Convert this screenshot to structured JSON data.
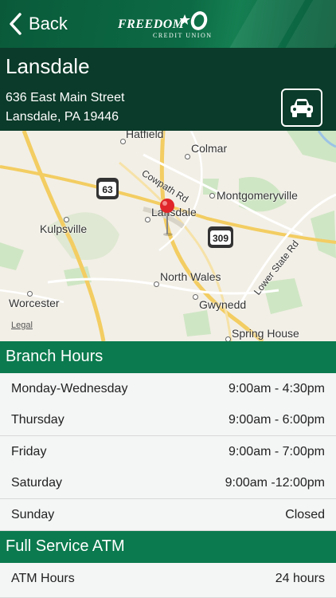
{
  "nav": {
    "back_label": "Back",
    "logo_main": "FREEDOM",
    "logo_sub": "CREDIT UNION"
  },
  "branch": {
    "name": "Lansdale",
    "address_line1": "636 East Main Street",
    "address_line2": "Lansdale, PA 19446"
  },
  "map": {
    "labels": {
      "hatfield": "Hatfield",
      "colmar": "Colmar",
      "cowpath": "Cowpath Rd",
      "montgomeryville": "Montgomeryville",
      "kulpsville": "Kulpsville",
      "lansdale": "Lansdale",
      "north_wales": "North Wales",
      "lower_state": "Lower State Rd",
      "worcester": "Worcester",
      "gwynedd": "Gwynedd",
      "spring_house": "Spring House"
    },
    "shields": {
      "route63": "63",
      "route309": "309"
    },
    "legal": "Legal"
  },
  "hours": {
    "title": "Branch Hours",
    "rows": [
      {
        "day": "Monday-Wednesday",
        "time": "9:00am - 4:30pm"
      },
      {
        "day": "Thursday",
        "time": "9:00am - 6:00pm"
      },
      {
        "day": "Friday",
        "time": "9:00am - 7:00pm"
      },
      {
        "day": "Saturday",
        "time": "9:00am -12:00pm"
      },
      {
        "day": "Sunday",
        "time": "Closed"
      }
    ]
  },
  "atm": {
    "title": "Full Service ATM",
    "rows": [
      {
        "label": "ATM Hours",
        "value": "24 hours"
      }
    ]
  }
}
